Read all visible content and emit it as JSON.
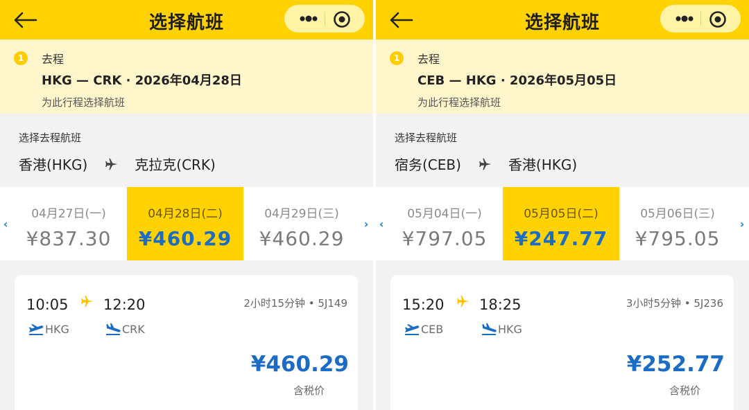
{
  "screens": [
    {
      "header": {
        "title": "选择航班"
      },
      "trip": {
        "step": "1",
        "type": "去程",
        "route": "HKG — CRK · 2026年04月28日",
        "subtitle": "为此行程选择航班"
      },
      "route_section": {
        "label": "选择去程航班",
        "origin": "香港(HKG)",
        "destination": "克拉克(CRK)"
      },
      "dates": [
        {
          "label": "04月27日(一)",
          "price": "¥837.30"
        },
        {
          "label": "04月28日(二)",
          "price": "¥460.29",
          "selected": true
        },
        {
          "label": "04月29日(三)",
          "price": "¥460.29"
        }
      ],
      "flight": {
        "dep_time": "10:05",
        "arr_time": "12:20",
        "duration": "2小时15分钟 • 5J149",
        "dep_code": "HKG",
        "arr_code": "CRK",
        "price": "¥460.29",
        "price_note": "含税价"
      }
    },
    {
      "header": {
        "title": "选择航班"
      },
      "trip": {
        "step": "1",
        "type": "去程",
        "route": "CEB — HKG · 2026年05月05日",
        "subtitle": "为此行程选择航班"
      },
      "route_section": {
        "label": "选择去程航班",
        "origin": "宿务(CEB)",
        "destination": "香港(HKG)"
      },
      "dates": [
        {
          "label": "05月04日(一)",
          "price": "¥797.05"
        },
        {
          "label": "05月05日(二)",
          "price": "¥247.77",
          "selected": true
        },
        {
          "label": "05月06日(三)",
          "price": "¥795.05"
        }
      ],
      "flight": {
        "dep_time": "15:20",
        "arr_time": "18:25",
        "duration": "3小时5分钟 • 5J236",
        "dep_code": "CEB",
        "arr_code": "HKG",
        "price": "¥252.77",
        "price_note": "含税价"
      }
    }
  ],
  "colors": {
    "brand_yellow": "#ffd200",
    "price_blue": "#1a6cc4",
    "arrow_blue": "#1a7fd4"
  },
  "icons": [
    "back-arrow-icon",
    "more-dots-icon",
    "target-icon",
    "airplane-icon",
    "takeoff-icon",
    "landing-icon",
    "chevron-left-icon",
    "chevron-right-icon"
  ]
}
